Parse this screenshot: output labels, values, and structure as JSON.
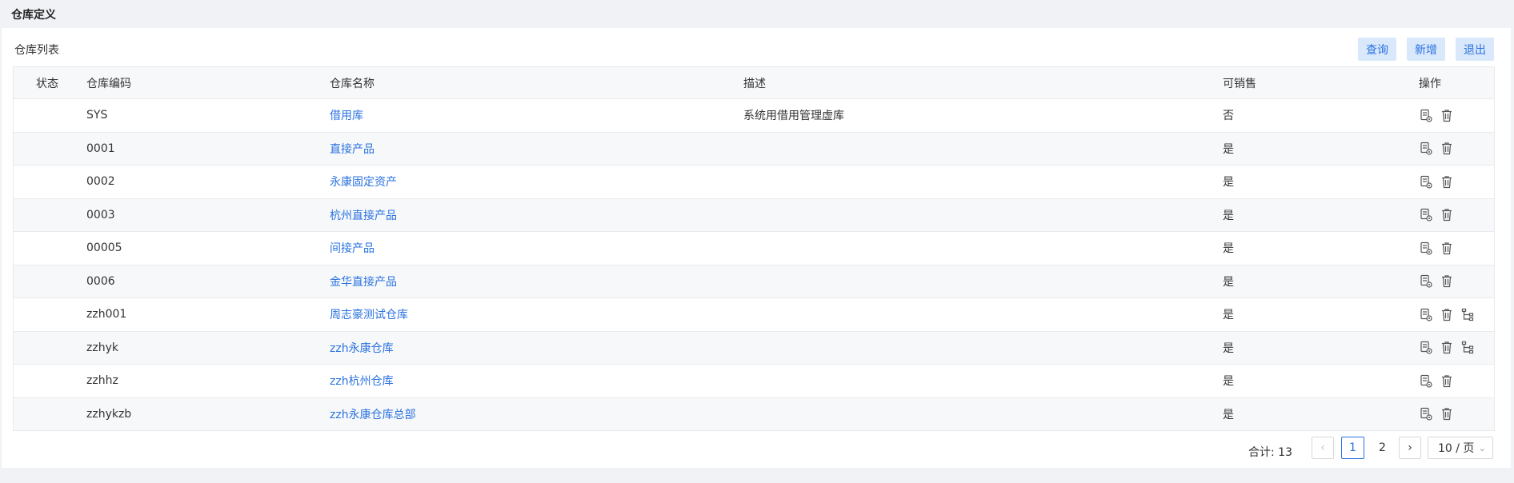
{
  "page": {
    "title": "仓库定义"
  },
  "panel": {
    "title": "仓库列表"
  },
  "toolbar": {
    "query_label": "查询",
    "add_label": "新增",
    "exit_label": "退出"
  },
  "table": {
    "headers": {
      "status": "状态",
      "code": "仓库编码",
      "name": "仓库名称",
      "desc": "描述",
      "sale": "可销售",
      "op": "操作"
    },
    "rows": [
      {
        "code": "SYS",
        "name": "借用库",
        "desc": "系统用借用管理虚库",
        "sale": "否",
        "tree": false
      },
      {
        "code": "0001",
        "name": "直接产品",
        "desc": "",
        "sale": "是",
        "tree": false
      },
      {
        "code": "0002",
        "name": "永康固定资产",
        "desc": "",
        "sale": "是",
        "tree": false
      },
      {
        "code": "0003",
        "name": "杭州直接产品",
        "desc": "",
        "sale": "是",
        "tree": false
      },
      {
        "code": "00005",
        "name": "间接产品",
        "desc": "",
        "sale": "是",
        "tree": false
      },
      {
        "code": "0006",
        "name": "金华直接产品",
        "desc": "",
        "sale": "是",
        "tree": false
      },
      {
        "code": "zzh001",
        "name": "周志豪测试仓库",
        "desc": "",
        "sale": "是",
        "tree": true
      },
      {
        "code": "zzhyk",
        "name": "zzh永康仓库",
        "desc": "",
        "sale": "是",
        "tree": true
      },
      {
        "code": "zzhhz",
        "name": "zzh杭州仓库",
        "desc": "",
        "sale": "是",
        "tree": false
      },
      {
        "code": "zzhykzb",
        "name": "zzh永康仓库总部",
        "desc": "",
        "sale": "是",
        "tree": false
      }
    ]
  },
  "pagination": {
    "total_label": "合计: 13",
    "pages": [
      "1",
      "2"
    ],
    "current": "1",
    "page_size": "10 / 页",
    "prev_icon": "chevron-left-icon",
    "next_icon": "chevron-right-icon"
  },
  "colors": {
    "accent": "#2a72e0",
    "button_bg": "#d9e8fb",
    "page_bg": "#f0f2f5"
  }
}
